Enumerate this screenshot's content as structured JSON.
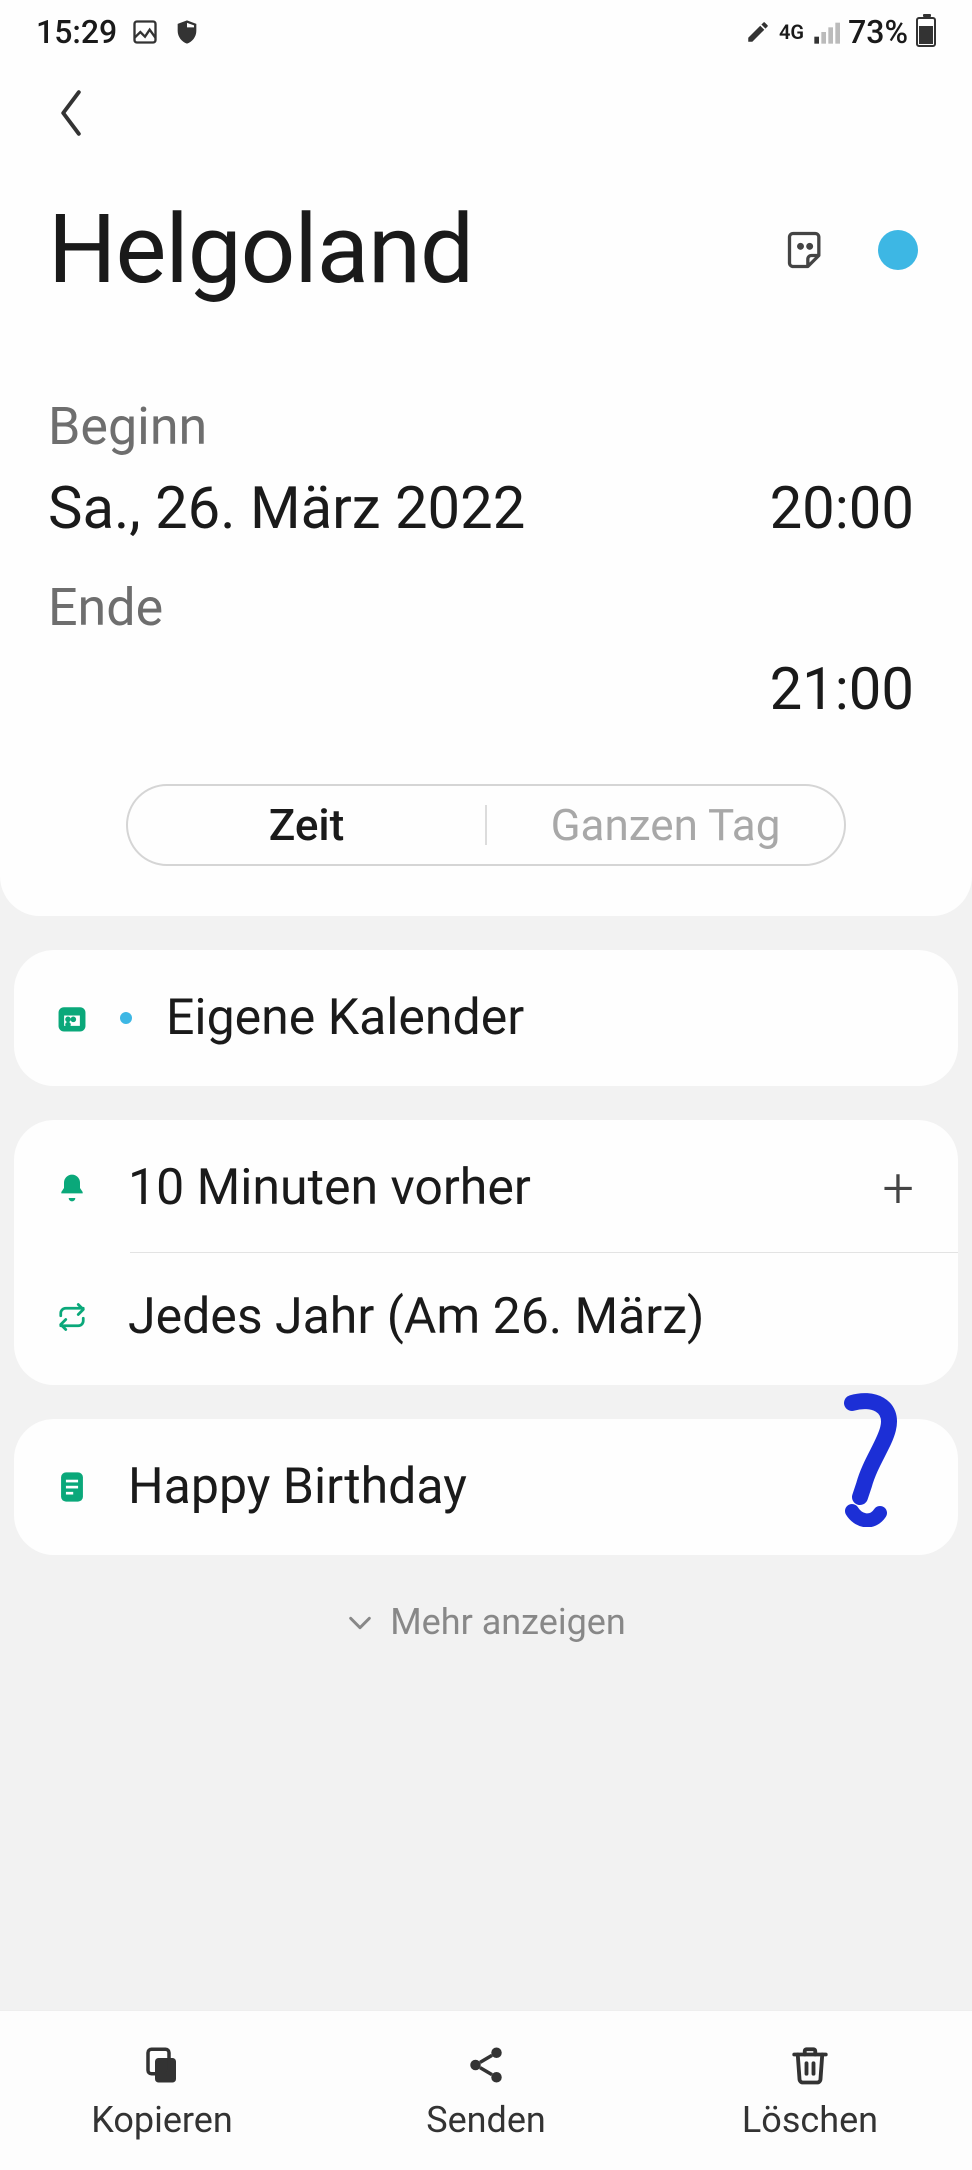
{
  "status": {
    "time": "15:29",
    "network": "4G",
    "battery_pct": "73%"
  },
  "event": {
    "title": "Helgoland",
    "color": "#3db7e4"
  },
  "datetime": {
    "begin_label": "Beginn",
    "begin_date": "Sa., 26. März 2022",
    "begin_time": "20:00",
    "end_label": "Ende",
    "end_time": "21:00"
  },
  "segment": {
    "time": "Zeit",
    "allday": "Ganzen Tag"
  },
  "calendar": {
    "name": "Eigene Kalender"
  },
  "alert": {
    "text": "10 Minuten vorher"
  },
  "repeat": {
    "text": "Jedes Jahr (Am 26. März)"
  },
  "note": {
    "text": "Happy Birthday"
  },
  "more": "Mehr anzeigen",
  "bottom": {
    "copy": "Kopieren",
    "send": "Senden",
    "delete": "Löschen"
  }
}
